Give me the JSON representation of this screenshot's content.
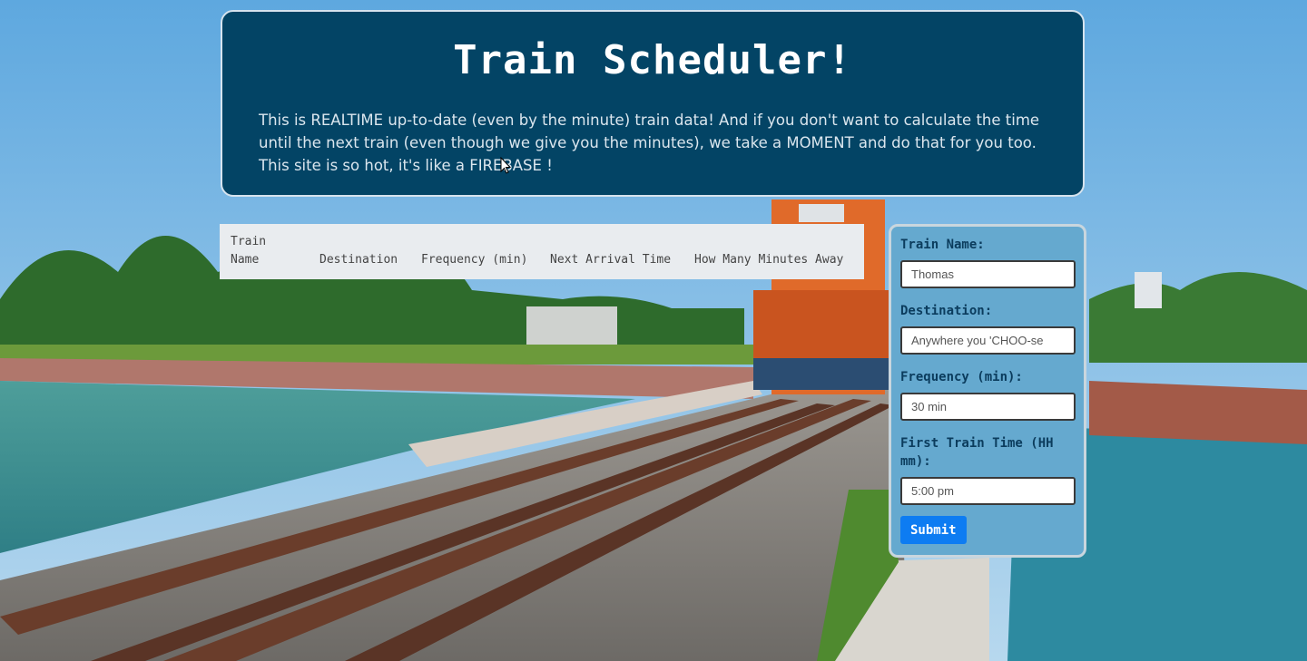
{
  "header": {
    "title": "Train Scheduler!",
    "description": "This is REALTIME up-to-date (even by the minute) train data! And if you don't want to calculate the time until the next train (even though we give you the minutes), we take a MOMENT and do that for you too. This site is so hot, it's like a FIREBASE !"
  },
  "table": {
    "columns": [
      "Train Name",
      "Destination",
      "Frequency (min)",
      "Next Arrival Time",
      "How Many Minutes Away"
    ]
  },
  "form": {
    "train_name": {
      "label": "Train Name:",
      "placeholder": "Thomas"
    },
    "destination": {
      "label": "Destination:",
      "placeholder": "Anywhere you 'CHOO-se"
    },
    "frequency": {
      "label": "Frequency (min):",
      "placeholder": "30 min"
    },
    "first_time": {
      "label": "First Train Time (HH mm):",
      "placeholder": "5:00 pm"
    },
    "submit_label": "Submit"
  },
  "colors": {
    "header_bg": "#034465",
    "form_bg": "#65a9cf",
    "submit_bg": "#0d7cf2"
  }
}
